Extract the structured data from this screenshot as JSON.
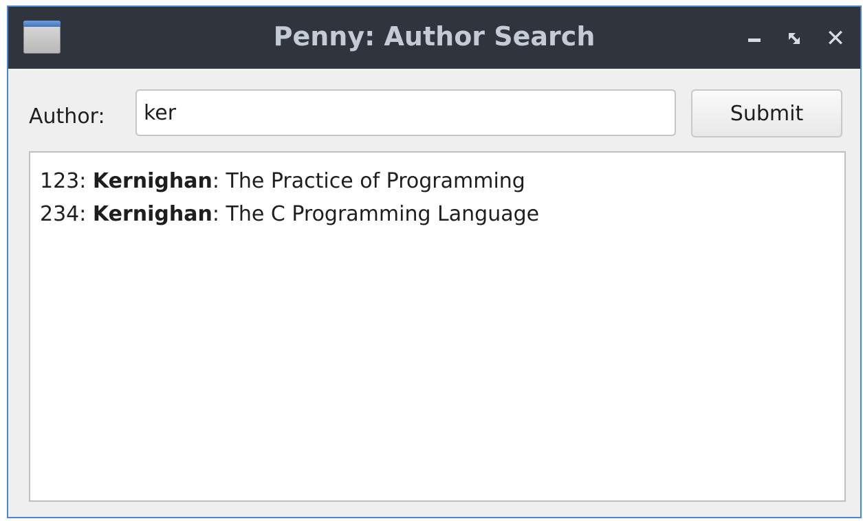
{
  "window": {
    "title": "Penny: Author Search",
    "controls": {
      "maximize_glyph": "⤢",
      "close_glyph": "✕"
    }
  },
  "form": {
    "author_label": "Author:",
    "author_value": "ker",
    "submit_label": "Submit"
  },
  "results": [
    {
      "id": "123",
      "id_sep": ": ",
      "author": "Kernighan",
      "title_sep": ": ",
      "title": "The Practice of Programming"
    },
    {
      "id": "234",
      "id_sep": ": ",
      "author": "Kernighan",
      "title_sep": ": ",
      "title": "The C Programming Language"
    }
  ],
  "colors": {
    "titlebar": "#2f343d",
    "window_border": "#4a86d4",
    "background": "#efefef"
  }
}
